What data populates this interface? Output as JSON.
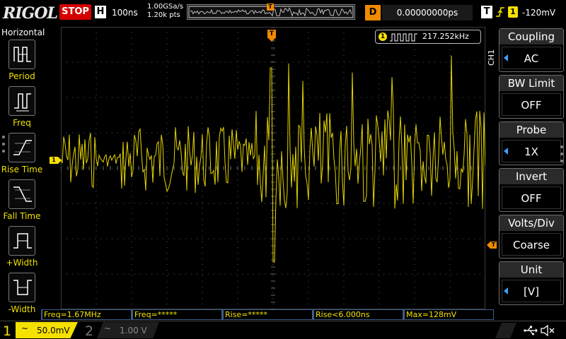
{
  "header": {
    "brand": "RIGOL",
    "run_state": "STOP",
    "horizontal_badge": "H",
    "timebase": "100ns",
    "sample_rate": "1.00GSa/s",
    "memory_depth": "1.20k pts",
    "trigger_marker": "T",
    "delay_badge": "D",
    "delay_value": "0.00000000ps",
    "trigger_badge": "T",
    "trigger_source": "1",
    "trigger_level": "-120mV"
  },
  "left_menu": {
    "title": "Horizontal",
    "items": [
      {
        "label": "Period",
        "icon": "period-icon"
      },
      {
        "label": "Freq",
        "icon": "frequency-icon"
      },
      {
        "label": "Rise Time",
        "icon": "rise-time-icon"
      },
      {
        "label": "Fall Time",
        "icon": "fall-time-icon"
      },
      {
        "label": "+Width",
        "icon": "positive-width-icon"
      },
      {
        "label": "-Width",
        "icon": "negative-width-icon"
      }
    ]
  },
  "waveform": {
    "trigger_top_marker": "T",
    "channel_marker": "1",
    "counter_channel": "1",
    "counter_value": "217.252kHz",
    "colors": {
      "trace": "#e4d400",
      "grid": "#3a3a3a",
      "trigger": "#f08a00"
    }
  },
  "right_menu": {
    "channel_tab": "CH1",
    "items": [
      {
        "title": "Coupling",
        "value": "AC",
        "knob": true
      },
      {
        "title": "BW Limit",
        "value": "OFF",
        "knob": false
      },
      {
        "title": "Probe",
        "value": "1X",
        "knob": true
      },
      {
        "title": "Invert",
        "value": "OFF",
        "knob": false
      },
      {
        "title": "Volts/Div",
        "value": "Coarse",
        "knob": false
      },
      {
        "title": "Unit",
        "value": "[V]",
        "knob": true
      }
    ]
  },
  "measurements": [
    {
      "text": "Freq=1.67MHz"
    },
    {
      "text": "Freq=*****"
    },
    {
      "text": "Rise=*****"
    },
    {
      "text": "Rise<6.000ns"
    },
    {
      "text": "Max=128mV"
    }
  ],
  "footer": {
    "ch1_number": "1",
    "ch1_coupling": "~",
    "ch1_scale": "50.0mV",
    "ch2_number": "2",
    "ch2_coupling": "~",
    "ch2_scale": "1.00 V",
    "icons": [
      "usb-icon",
      "mute-icon"
    ]
  }
}
